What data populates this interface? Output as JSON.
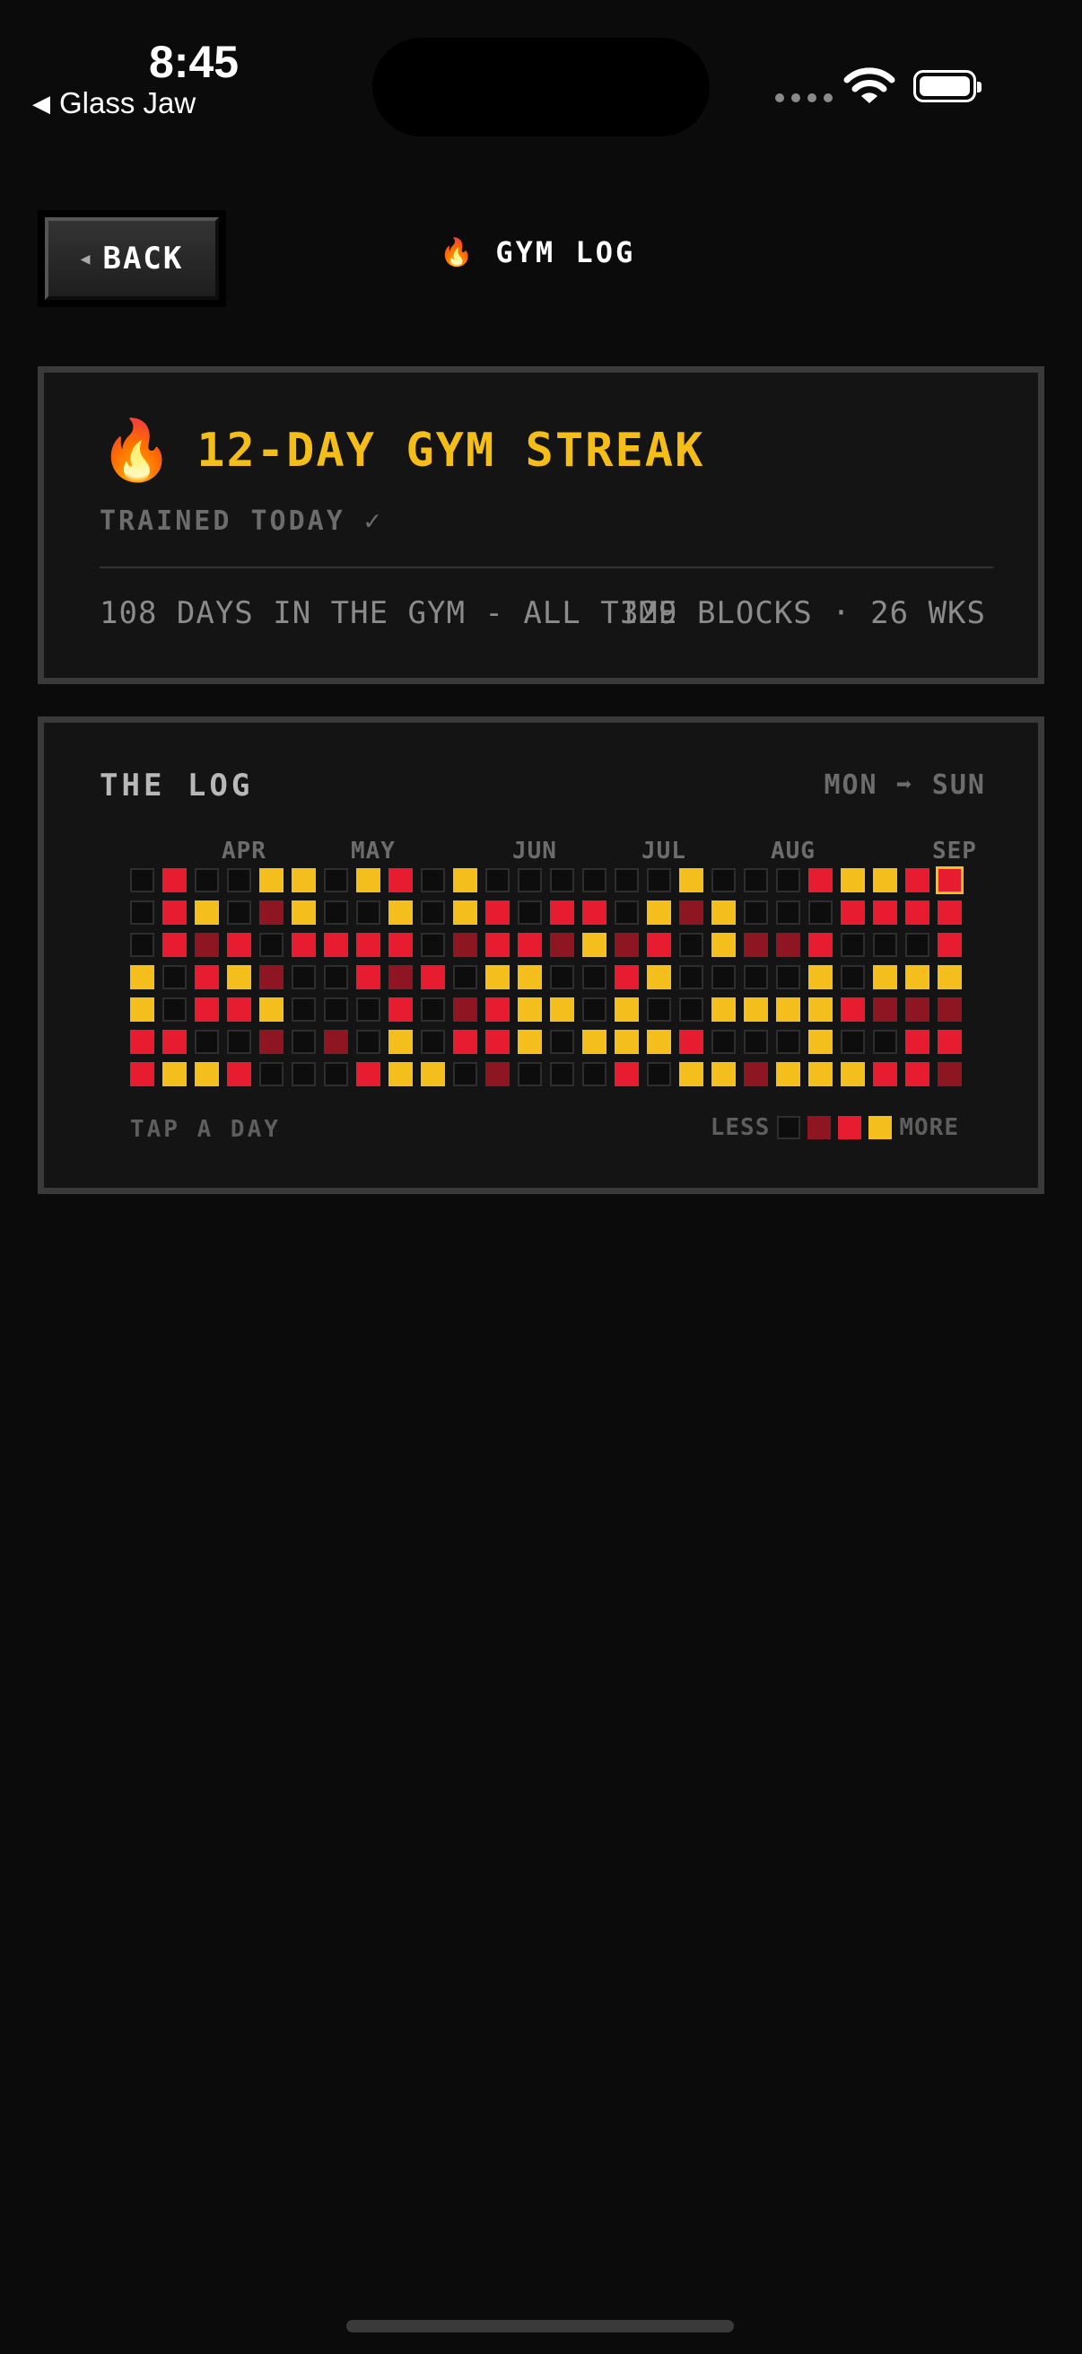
{
  "status_bar": {
    "time": "8:45",
    "back_app": "Glass Jaw"
  },
  "header": {
    "back_label": "BACK",
    "title": "GYM LOG",
    "title_icon": "fire-icon"
  },
  "streak": {
    "title": "12-DAY GYM STREAK",
    "trained_today": "TRAINED TODAY ✓",
    "all_time": "108 DAYS IN THE GYM - ALL TIME",
    "blocks_weeks": "329 BLOCKS · 26 WKS"
  },
  "log": {
    "title": "THE LOG",
    "range": "MON ➡ SUN",
    "months": [
      "APR",
      "MAY",
      "JUN",
      "JUL",
      "AUG",
      "SEP"
    ],
    "tap_hint": "TAP A DAY",
    "legend_less": "LESS",
    "legend_more": "MORE",
    "level_colors": [
      "#0d0d0d",
      "#8d1622",
      "#e81c30",
      "#f4bf1c"
    ],
    "today": {
      "week": 25,
      "day": 0
    },
    "weeks": [
      [
        0,
        0,
        0,
        3,
        3,
        2,
        2
      ],
      [
        2,
        2,
        2,
        0,
        0,
        2,
        3
      ],
      [
        0,
        3,
        1,
        2,
        2,
        0,
        3
      ],
      [
        0,
        0,
        2,
        3,
        2,
        0,
        2
      ],
      [
        3,
        1,
        0,
        1,
        3,
        1,
        0
      ],
      [
        3,
        3,
        2,
        0,
        0,
        0,
        0
      ],
      [
        0,
        0,
        2,
        0,
        0,
        1,
        0
      ],
      [
        3,
        0,
        2,
        2,
        0,
        0,
        2
      ],
      [
        2,
        3,
        2,
        1,
        2,
        3,
        3
      ],
      [
        0,
        0,
        0,
        2,
        0,
        0,
        3
      ],
      [
        3,
        3,
        1,
        0,
        1,
        2,
        0
      ],
      [
        0,
        2,
        2,
        3,
        2,
        2,
        1
      ],
      [
        0,
        0,
        2,
        3,
        3,
        3,
        0
      ],
      [
        0,
        2,
        1,
        0,
        3,
        0,
        0
      ],
      [
        0,
        2,
        3,
        0,
        0,
        3,
        0
      ],
      [
        0,
        0,
        1,
        2,
        3,
        3,
        2
      ],
      [
        0,
        3,
        2,
        3,
        0,
        3,
        0
      ],
      [
        3,
        1,
        0,
        0,
        0,
        2,
        3
      ],
      [
        0,
        3,
        3,
        0,
        3,
        0,
        3
      ],
      [
        0,
        0,
        1,
        0,
        3,
        0,
        1
      ],
      [
        0,
        0,
        1,
        0,
        3,
        0,
        3
      ],
      [
        2,
        0,
        2,
        3,
        3,
        3,
        3
      ],
      [
        3,
        2,
        0,
        0,
        2,
        0,
        3
      ],
      [
        3,
        2,
        0,
        3,
        1,
        0,
        2
      ],
      [
        2,
        2,
        0,
        3,
        1,
        2,
        2
      ],
      [
        2,
        2,
        2,
        3,
        1,
        2,
        1
      ]
    ]
  }
}
